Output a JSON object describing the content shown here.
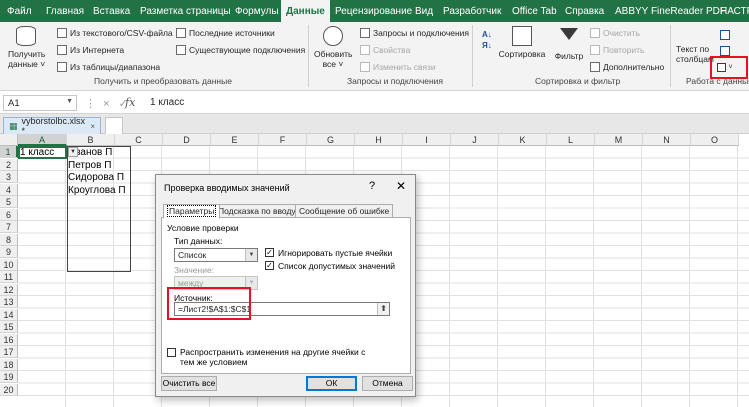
{
  "menu": {
    "tabs": [
      "Файл",
      "Главная",
      "Вставка",
      "Разметка страницы",
      "Формулы",
      "Данные",
      "Рецензирование",
      "Вид",
      "Разработчик",
      "Office Tab",
      "Справка",
      "ABBYY FineReader PDF",
      "НАСТР"
    ],
    "active_tab": "Данные"
  },
  "ribbon": {
    "get_data": {
      "big_button": [
        "Получить",
        "данные ˅"
      ],
      "from_text_csv": "Из текстового/CSV-файла",
      "from_web": "Из Интернета",
      "from_table": "Из таблицы/диапазона",
      "recent_sources": "Последние источники",
      "existing_connections": "Существующие подключения",
      "group_label": "Получить и преобразовать данные"
    },
    "queries": {
      "refresh_all": [
        "Обновить",
        "все ˅"
      ],
      "queries_connections": "Запросы и подключения",
      "properties": "Свойства",
      "edit_links": "Изменить связи",
      "group_label": "Запросы и подключения"
    },
    "sort_filter": {
      "sort": "Сортировка",
      "filter": "Фильтр",
      "clear": "Очистить",
      "reapply": "Повторить",
      "advanced": "Дополнительно",
      "group_label": "Сортировка и фильтр"
    },
    "data_tools": {
      "text_to_columns": [
        "Текст по",
        "столбцам"
      ],
      "group_label": "Работа с данными"
    }
  },
  "formula_bar": {
    "name_box": "A1",
    "cancel_icon": "×",
    "enter_icon": "✓",
    "fx": "fx",
    "value": "1 класс"
  },
  "workbook_tabs": {
    "file": "vyborstolbc.xlsx *",
    "close": "×"
  },
  "grid": {
    "columns": [
      "A",
      "B",
      "C",
      "D",
      "E",
      "F",
      "G",
      "H",
      "I",
      "J",
      "K",
      "L",
      "M",
      "N",
      "O"
    ],
    "rows": [
      "1",
      "2",
      "3",
      "4",
      "5",
      "6",
      "7",
      "8",
      "9",
      "10",
      "11",
      "12",
      "13",
      "14",
      "15",
      "16",
      "17",
      "18",
      "19",
      "20"
    ],
    "cells": {
      "A1": "1 класс",
      "B1": "Иванов П",
      "B2": "Петров П",
      "B3": "Сидорова П",
      "B4": "Кроуглова П"
    }
  },
  "dialog": {
    "title": "Проверка вводимых значений",
    "help": "?",
    "close": "✕",
    "tabs": [
      "Параметры",
      "Подсказка по вводу",
      "Сообщение об ошибке"
    ],
    "active_tab": "Параметры",
    "section_title": "Условие проверки",
    "data_type_label": "Тип данных:",
    "data_type_value": "Список",
    "value_label": "Значение:",
    "value_value": "между",
    "ignore_blank_label": "Игнорировать пустые ячейки",
    "ignore_blank_checked": true,
    "in_cell_dropdown_label": "Список допустимых значений",
    "in_cell_dropdown_checked": true,
    "source_label": "Источник:",
    "source_value": "=Лист2!$A$1:$C$1",
    "apply_all_label": "Распространить изменения на другие ячейки с тем же условием",
    "clear_all_button": "Очистить все",
    "ok_button": "ОК",
    "cancel_button": "Отмена"
  },
  "colors": {
    "excel_green": "#217346",
    "highlight_red": "#e81123"
  }
}
